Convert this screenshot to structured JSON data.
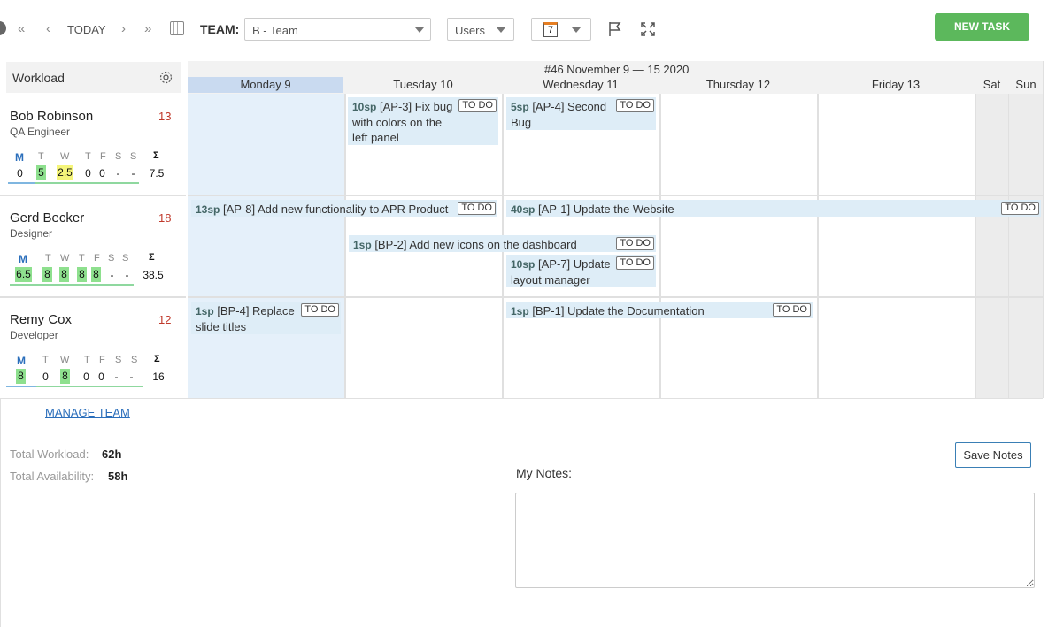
{
  "toolbar": {
    "today": "TODAY",
    "team_label": "TEAM:",
    "team_value": "B - Team",
    "view_value": "Users",
    "calendar_num": "7",
    "new_task": "NEW TASK"
  },
  "calendar": {
    "week_title": "#46 November 9 — 15 2020",
    "days": [
      "Monday 9",
      "Tuesday 10",
      "Wednesday 11",
      "Thursday 12",
      "Friday 13",
      "Sat",
      "Sun"
    ]
  },
  "sidebar": {
    "title": "Workload",
    "week_letters": [
      "M",
      "T",
      "W",
      "T",
      "F",
      "S",
      "S",
      "Σ"
    ]
  },
  "people": [
    {
      "name": "Bob Robinson",
      "role": "QA Engineer",
      "count": "13",
      "values": [
        "0",
        "5",
        "2.5",
        "0",
        "0",
        "-",
        "-",
        "7.5"
      ]
    },
    {
      "name": "Gerd Becker",
      "role": "Designer",
      "count": "18",
      "values": [
        "6.5",
        "8",
        "8",
        "8",
        "8",
        "-",
        "-",
        "38.5"
      ]
    },
    {
      "name": "Remy Cox",
      "role": "Developer",
      "count": "12",
      "values": [
        "8",
        "0",
        "8",
        "0",
        "0",
        "-",
        "-",
        "16"
      ]
    }
  ],
  "tasks": [
    {
      "sp": "10sp",
      "text": "[AP-3] Fix bug with colors on the left panel",
      "status": "TO DO"
    },
    {
      "sp": "5sp",
      "text": "[AP-4] Second Bug",
      "status": "TO DO"
    },
    {
      "sp": "13sp",
      "text": "[AP-8] Add new functionality to APR Product",
      "status": "TO DO"
    },
    {
      "sp": "40sp",
      "text": "[AP-1] Update the Website",
      "status": "TO DO"
    },
    {
      "sp": "1sp",
      "text": "[BP-2] Add new icons on the dashboard",
      "status": "TO DO"
    },
    {
      "sp": "10sp",
      "text": "[AP-7] Update layout manager",
      "status": "TO DO"
    },
    {
      "sp": "1sp",
      "text": "[BP-4] Replace slide titles",
      "status": "TO DO"
    },
    {
      "sp": "1sp",
      "text": "[BP-1] Update the Documentation",
      "status": "TO DO"
    }
  ],
  "footer": {
    "manage_team": "MANAGE TEAM",
    "total_workload_label": "Total Workload:",
    "total_workload_value": "62h",
    "total_availability_label": "Total Availability:",
    "total_availability_value": "58h",
    "save_notes": "Save Notes",
    "my_notes": "My Notes:"
  }
}
